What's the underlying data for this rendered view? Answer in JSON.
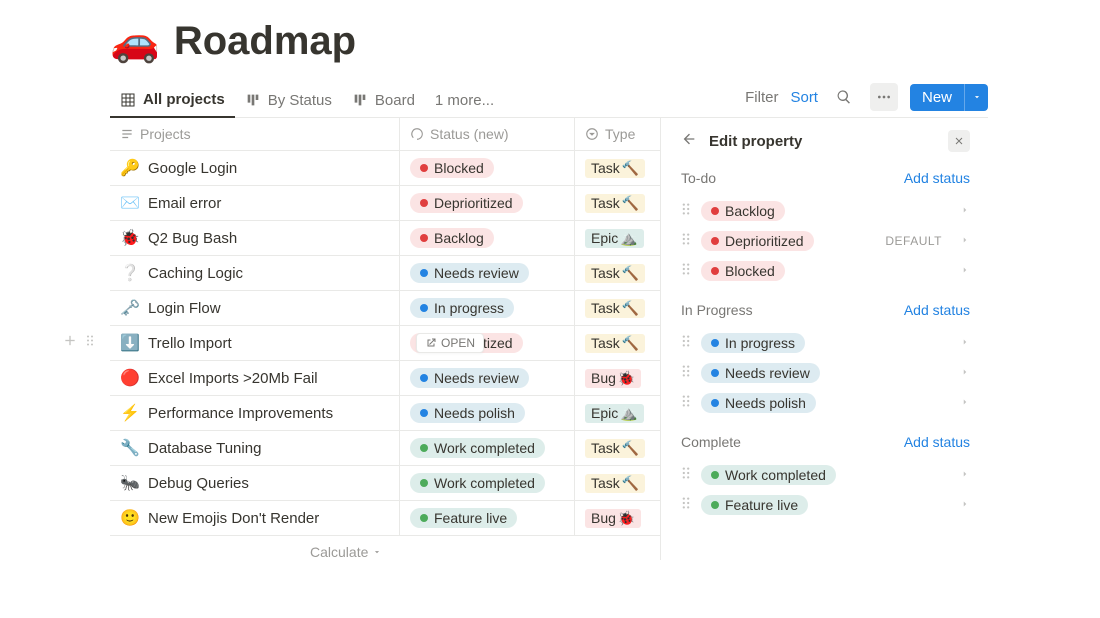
{
  "page": {
    "emoji": "🚗",
    "title": "Roadmap"
  },
  "views": [
    {
      "label": "All projects",
      "icon": "table",
      "active": true
    },
    {
      "label": "By Status",
      "icon": "board",
      "active": false
    },
    {
      "label": "Board",
      "icon": "board",
      "active": false
    }
  ],
  "views_more": "1 more...",
  "toolbar": {
    "filter": "Filter",
    "sort": "Sort",
    "new": "New"
  },
  "columns": {
    "projects": "Projects",
    "status": "Status (new)",
    "type": "Type"
  },
  "status_styles": {
    "Blocked": {
      "bg": "bg-red-light",
      "dot": "dot-red"
    },
    "Deprioritized": {
      "bg": "bg-red-light",
      "dot": "dot-red"
    },
    "Backlog": {
      "bg": "bg-red-light",
      "dot": "dot-red"
    },
    "Needs review": {
      "bg": "bg-blue-light",
      "dot": "dot-blue"
    },
    "In progress": {
      "bg": "bg-blue-light",
      "dot": "dot-blue"
    },
    "Needs polish": {
      "bg": "bg-blue-light",
      "dot": "dot-blue"
    },
    "Work completed": {
      "bg": "bg-green-light",
      "dot": "dot-green"
    },
    "Feature live": {
      "bg": "bg-green-light",
      "dot": "dot-green"
    }
  },
  "type_styles": {
    "Task": {
      "bg": "bg-yellow-light",
      "emoji": "🔨"
    },
    "Epic": {
      "bg": "bg-teal-light",
      "emoji": "⛰️"
    },
    "Bug": {
      "bg": "bg-pink-light",
      "emoji": "🐞"
    }
  },
  "rows": [
    {
      "emoji": "🔑",
      "name": "Google Login",
      "status": "Blocked",
      "type": "Task"
    },
    {
      "emoji": "✉️",
      "name": "Email error",
      "status": "Deprioritized",
      "type": "Task"
    },
    {
      "emoji": "🐞",
      "name": "Q2 Bug Bash",
      "status": "Backlog",
      "type": "Epic"
    },
    {
      "emoji": "❔",
      "name": "Caching Logic",
      "status": "Needs review",
      "type": "Task"
    },
    {
      "emoji": "🗝️",
      "name": "Login Flow",
      "status": "In progress",
      "type": "Task"
    },
    {
      "emoji": "⬇️",
      "name": "Trello Import",
      "status": "Deprioritized",
      "type": "Task",
      "hovered": true
    },
    {
      "emoji": "🔴",
      "name": "Excel Imports >20Mb Fail",
      "status": "Needs review",
      "type": "Bug"
    },
    {
      "emoji": "⚡",
      "name": "Performance Improvements",
      "status": "Needs polish",
      "type": "Epic"
    },
    {
      "emoji": "🔧",
      "name": "Database Tuning",
      "status": "Work completed",
      "type": "Task"
    },
    {
      "emoji": "🐜",
      "name": "Debug Queries",
      "status": "Work completed",
      "type": "Task"
    },
    {
      "emoji": "🙂",
      "name": "New Emojis Don't Render",
      "status": "Feature live",
      "type": "Bug"
    }
  ],
  "open_label": "OPEN",
  "calculate_label": "Calculate",
  "side_panel": {
    "title": "Edit property",
    "add_status": "Add status",
    "default_label": "DEFAULT",
    "groups": [
      {
        "title": "To-do",
        "items": [
          {
            "label": "Backlog",
            "default": false
          },
          {
            "label": "Deprioritized",
            "default": true
          },
          {
            "label": "Blocked",
            "default": false
          }
        ]
      },
      {
        "title": "In Progress",
        "items": [
          {
            "label": "In progress",
            "default": false
          },
          {
            "label": "Needs review",
            "default": false
          },
          {
            "label": "Needs polish",
            "default": false
          }
        ]
      },
      {
        "title": "Complete",
        "items": [
          {
            "label": "Work completed",
            "default": false
          },
          {
            "label": "Feature live",
            "default": false
          }
        ]
      }
    ]
  }
}
